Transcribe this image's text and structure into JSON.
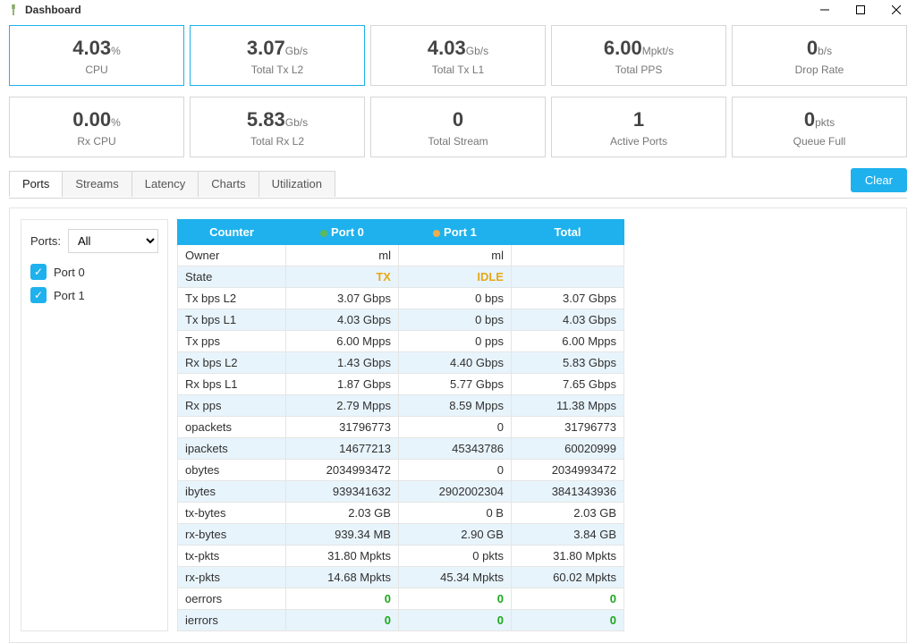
{
  "window": {
    "title": "Dashboard"
  },
  "cards_row1": [
    {
      "value": "4.03",
      "unit": "%",
      "label": "CPU",
      "selected": true
    },
    {
      "value": "3.07",
      "unit": "Gb/s",
      "label": "Total Tx L2",
      "selected": true
    },
    {
      "value": "4.03",
      "unit": "Gb/s",
      "label": "Total Tx L1",
      "selected": false
    },
    {
      "value": "6.00",
      "unit": "Mpkt/s",
      "label": "Total PPS",
      "selected": false
    },
    {
      "value": "0",
      "unit": "b/s",
      "label": "Drop Rate",
      "selected": false
    }
  ],
  "cards_row2": [
    {
      "value": "0.00",
      "unit": "%",
      "label": "Rx CPU",
      "selected": false
    },
    {
      "value": "5.83",
      "unit": "Gb/s",
      "label": "Total Rx L2",
      "selected": false
    },
    {
      "value": "0",
      "unit": "",
      "label": "Total Stream",
      "selected": false
    },
    {
      "value": "1",
      "unit": "",
      "label": "Active Ports",
      "selected": false
    },
    {
      "value": "0",
      "unit": "pkts",
      "label": "Queue Full",
      "selected": false
    }
  ],
  "tabs": [
    "Ports",
    "Streams",
    "Latency",
    "Charts",
    "Utilization"
  ],
  "active_tab": 0,
  "clear_label": "Clear",
  "sidebar": {
    "ports_label": "Ports:",
    "ports_value": "All",
    "checkboxes": [
      {
        "label": "Port 0",
        "checked": true
      },
      {
        "label": "Port 1",
        "checked": true
      }
    ]
  },
  "table": {
    "headers": [
      "Counter",
      "Port 0",
      "Port 1",
      "Total"
    ],
    "port_dot_colors": [
      "green",
      "orange"
    ],
    "rows": [
      {
        "counter": "Owner",
        "p0": "ml",
        "p1": "ml",
        "total": ""
      },
      {
        "counter": "State",
        "p0": "TX",
        "p1": "IDLE",
        "total": "",
        "state": true
      },
      {
        "counter": "Tx bps L2",
        "p0": "3.07 Gbps",
        "p1": "0 bps",
        "total": "3.07 Gbps"
      },
      {
        "counter": "Tx bps L1",
        "p0": "4.03 Gbps",
        "p1": "0 bps",
        "total": "4.03 Gbps"
      },
      {
        "counter": "Tx pps",
        "p0": "6.00 Mpps",
        "p1": "0 pps",
        "total": "6.00 Mpps"
      },
      {
        "counter": "Rx bps L2",
        "p0": "1.43 Gbps",
        "p1": "4.40 Gbps",
        "total": "5.83 Gbps"
      },
      {
        "counter": "Rx bps L1",
        "p0": "1.87 Gbps",
        "p1": "5.77 Gbps",
        "total": "7.65 Gbps"
      },
      {
        "counter": "Rx pps",
        "p0": "2.79 Mpps",
        "p1": "8.59 Mpps",
        "total": "11.38 Mpps"
      },
      {
        "counter": "opackets",
        "p0": "31796773",
        "p1": "0",
        "total": "31796773"
      },
      {
        "counter": "ipackets",
        "p0": "14677213",
        "p1": "45343786",
        "total": "60020999"
      },
      {
        "counter": "obytes",
        "p0": "2034993472",
        "p1": "0",
        "total": "2034993472"
      },
      {
        "counter": "ibytes",
        "p0": "939341632",
        "p1": "2902002304",
        "total": "3841343936"
      },
      {
        "counter": "tx-bytes",
        "p0": "2.03 GB",
        "p1": "0 B",
        "total": "2.03 GB"
      },
      {
        "counter": "rx-bytes",
        "p0": "939.34 MB",
        "p1": "2.90 GB",
        "total": "3.84 GB"
      },
      {
        "counter": "tx-pkts",
        "p0": "31.80 Mpkts",
        "p1": "0 pkts",
        "total": "31.80 Mpkts"
      },
      {
        "counter": "rx-pkts",
        "p0": "14.68 Mpkts",
        "p1": "45.34 Mpkts",
        "total": "60.02 Mpkts"
      },
      {
        "counter": "oerrors",
        "p0": "0",
        "p1": "0",
        "total": "0",
        "green": true
      },
      {
        "counter": "ierrors",
        "p0": "0",
        "p1": "0",
        "total": "0",
        "green": true
      }
    ]
  }
}
